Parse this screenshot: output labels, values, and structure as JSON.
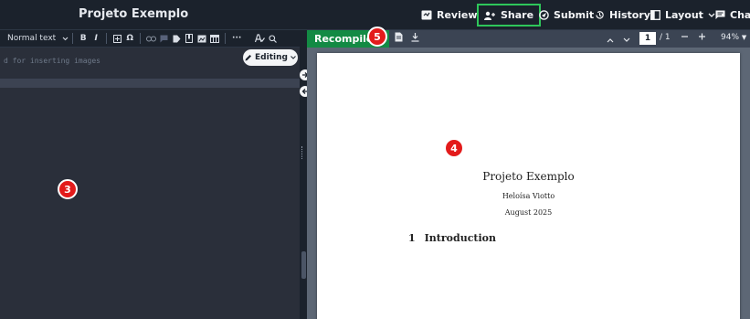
{
  "project": {
    "title": "Projeto Exemplo"
  },
  "header": {
    "review": "Review",
    "share": "Share",
    "submit": "Submit",
    "history": "History",
    "layout": "Layout",
    "chat": "Chat"
  },
  "editor_toolbar": {
    "text_style": "Normal text",
    "bold": "B",
    "italic": "I",
    "symbol": "Ω",
    "more": "···"
  },
  "editor": {
    "hint": "d for inserting images",
    "mode": "Editing"
  },
  "pdf_toolbar": {
    "recompile": "Recompile",
    "page_current": "1",
    "page_total": "/ 1",
    "zoom": "94%"
  },
  "pdf": {
    "title": "Projeto Exemplo",
    "author": "Heloísa Viotto",
    "date": "August 2025",
    "section_number": "1",
    "section_title": "Introduction"
  },
  "markers": {
    "editor": "3",
    "pdf": "4",
    "recompile": "5"
  },
  "colors": {
    "share_border": "#2ec65a",
    "recompile_bg": "#138a44",
    "marker": "#e31b1b"
  }
}
